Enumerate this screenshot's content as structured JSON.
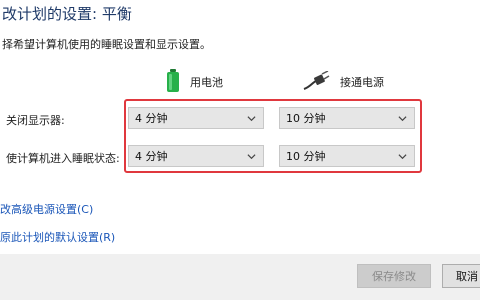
{
  "header": {
    "title": "改计划的设置: 平衡",
    "subtitle": "择希望计算机使用的睡眠设置和显示设置。"
  },
  "columns": {
    "battery": {
      "label": "用电池",
      "icon": "battery-icon",
      "color": "#27b04a"
    },
    "plugged": {
      "label": "接通电源",
      "icon": "power-plug-icon"
    }
  },
  "settings": {
    "rows": [
      {
        "label": "关闭显示器:",
        "battery_value": "4 分钟",
        "plugged_value": "10 分钟"
      },
      {
        "label": "使计算机进入睡眠状态:",
        "battery_value": "4 分钟",
        "plugged_value": "10 分钟"
      }
    ],
    "highlight_color": "#e0383e"
  },
  "links": {
    "advanced": "改高级电源设置(C)",
    "restore": "原此计划的默认设置(R)"
  },
  "footer": {
    "save_label": "保存修改",
    "cancel_label": "取消"
  }
}
